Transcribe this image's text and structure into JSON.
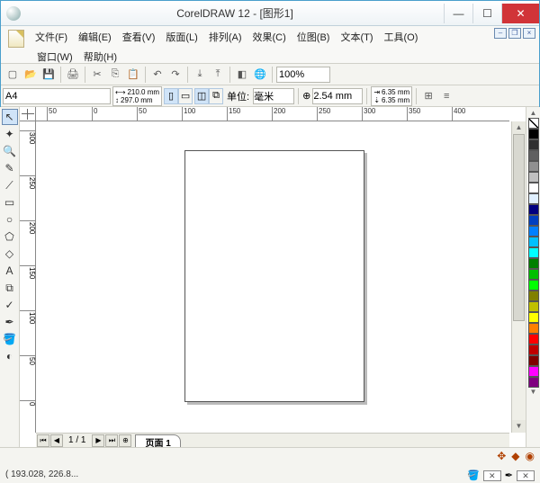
{
  "titlebar": {
    "title": "CorelDRAW 12 - [图形1]"
  },
  "menu": {
    "file": "文件(F)",
    "edit": "编辑(E)",
    "view": "查看(V)",
    "layout": "版面(L)",
    "arrange": "排列(A)",
    "effects": "效果(C)",
    "bitmap": "位图(B)",
    "text": "文本(T)",
    "tools": "工具(O)",
    "window": "窗口(W)",
    "help": "帮助(H)"
  },
  "toolbar": {
    "zoom": "100%"
  },
  "propbar": {
    "paper": "A4",
    "width": "210.0 mm",
    "height": "297.0 mm",
    "unit_label": "单位:",
    "unit": "毫米",
    "nudge": "2.54 mm",
    "dup_x": "6.35 mm",
    "dup_y": "6.35 mm"
  },
  "hruler": [
    {
      "v": "50",
      "p": 12
    },
    {
      "v": "0",
      "p": 62
    },
    {
      "v": "50",
      "p": 112
    },
    {
      "v": "100",
      "p": 162
    },
    {
      "v": "150",
      "p": 212
    },
    {
      "v": "200",
      "p": 262
    },
    {
      "v": "250",
      "p": 312
    },
    {
      "v": "300",
      "p": 362
    },
    {
      "v": "350",
      "p": 412
    },
    {
      "v": "400",
      "p": 462
    }
  ],
  "vruler": [
    {
      "v": "300",
      "p": 10
    },
    {
      "v": "250",
      "p": 60
    },
    {
      "v": "200",
      "p": 110
    },
    {
      "v": "150",
      "p": 160
    },
    {
      "v": "100",
      "p": 210
    },
    {
      "v": "50",
      "p": 260
    },
    {
      "v": "0",
      "p": 310
    }
  ],
  "pager": {
    "count": "1 / 1",
    "tab": "页面 1"
  },
  "palette": [
    "#000000",
    "#303030",
    "#606060",
    "#909090",
    "#c0c0c0",
    "#ffffff",
    "#e0f0ff",
    "#000080",
    "#0040c0",
    "#0080ff",
    "#00c0ff",
    "#00ffff",
    "#008000",
    "#00c000",
    "#00ff00",
    "#808000",
    "#c0c000",
    "#ffff00",
    "#ff8000",
    "#ff0000",
    "#c00000",
    "#800000",
    "#ff00ff",
    "#800080"
  ],
  "status": {
    "coords": "( 193.028, 226.8..."
  }
}
